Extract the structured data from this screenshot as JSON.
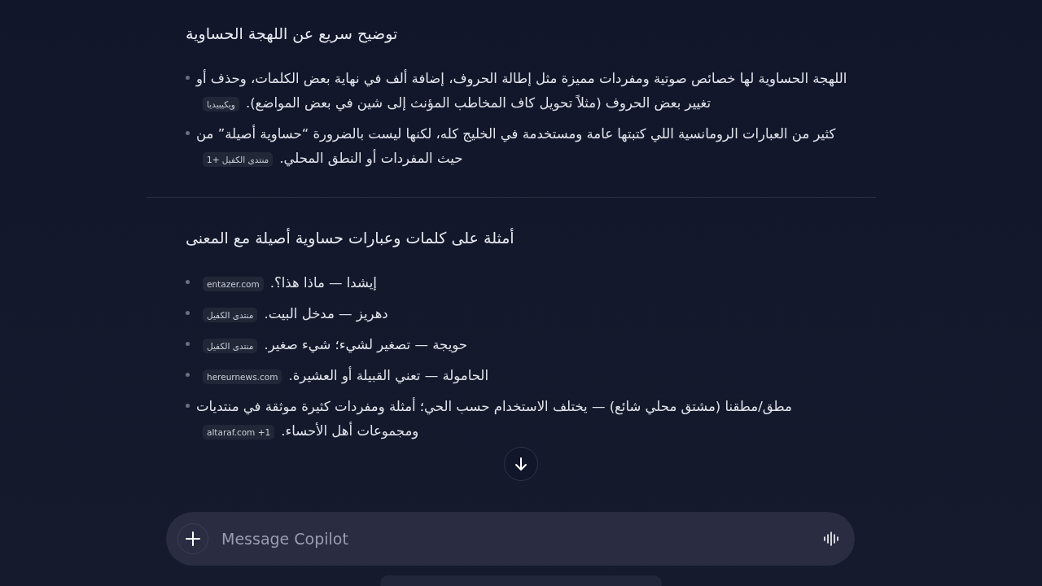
{
  "sections": [
    {
      "heading": "توضيح سريع عن اللهجة الحساوية",
      "items": [
        {
          "text": "اللهجة الحساوية لها خصائص صوتية ومفردات مميزة مثل إطالة الحروف، إضافة ألف في نهاية بعض الكلمات، وحذف أو تغيير بعض الحروف (مثلاً تحويل كاف المخاطب المؤنث إلى شين في بعض المواضع).",
          "citation": "ويكيبيديا"
        },
        {
          "text": "كثير من العبارات الرومانسية اللي كتبتها عامة ومستخدمة في الخليج كله، لكنها ليست بالضرورة “حساوية أصيلة” من حيث المفردات أو النطق المحلي.",
          "citation": "منتدى الكفيل +1"
        }
      ]
    },
    {
      "heading": "أمثلة على كلمات وعبارات حساوية أصيلة مع المعنى",
      "items": [
        {
          "text": "إيشدا — ماذا هذا؟.",
          "citation": "entazer.com"
        },
        {
          "text": "دهريز — مدخل البيت.",
          "citation": "منتدى الكفيل"
        },
        {
          "text": "حويجة — تصغير لشيء؛ شيء صغير.",
          "citation": "منتدى الكفيل"
        },
        {
          "text": "الحامولة — تعني القبيلة أو العشيرة.",
          "citation": "hereurnews.com"
        },
        {
          "text": "مطق/مطقنا (مشتق محلي شائع) — يختلف الاستخدام حسب الحي؛ أمثلة ومفردات كثيرة موثقة في منتديات ومجموعات أهل الأحساء.",
          "citation": "altaraf.com +1"
        }
      ]
    }
  ],
  "composer": {
    "placeholder": "Message Copilot"
  }
}
